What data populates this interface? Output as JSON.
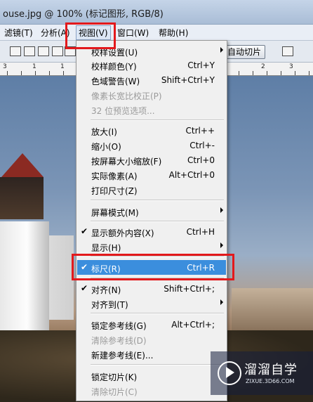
{
  "window": {
    "title": "ouse.jpg @ 100% (标记图形, RGB/8)"
  },
  "menubar": {
    "items": [
      {
        "label": "滤镜(T)"
      },
      {
        "label": "分析(A)"
      },
      {
        "label": "视图(V)",
        "active": true
      },
      {
        "label": "窗口(W)"
      },
      {
        "label": "帮助(H)"
      }
    ]
  },
  "options_bar": {
    "auto_slice_label": "自动切片"
  },
  "ruler": {
    "ticks": [
      "3",
      "1",
      "1",
      "2",
      "3"
    ]
  },
  "view_menu": {
    "items": [
      {
        "label": "校样设置(U)",
        "shortcut": "",
        "submenu": true
      },
      {
        "label": "校样颜色(Y)",
        "shortcut": "Ctrl+Y"
      },
      {
        "label": "色域警告(W)",
        "shortcut": "Shift+Ctrl+Y"
      },
      {
        "label": "像素长宽比校正(P)",
        "shortcut": "",
        "disabled": true
      },
      {
        "label": "32 位预览选项...",
        "shortcut": "",
        "disabled": true
      },
      {
        "label": "放大(I)",
        "shortcut": "Ctrl++"
      },
      {
        "label": "缩小(O)",
        "shortcut": "Ctrl+-"
      },
      {
        "label": "按屏幕大小缩放(F)",
        "shortcut": "Ctrl+0"
      },
      {
        "label": "实际像素(A)",
        "shortcut": "Alt+Ctrl+0"
      },
      {
        "label": "打印尺寸(Z)",
        "shortcut": ""
      },
      {
        "label": "屏幕模式(M)",
        "shortcut": "",
        "submenu": true
      },
      {
        "label": "显示额外内容(X)",
        "shortcut": "Ctrl+H",
        "checked": true
      },
      {
        "label": "显示(H)",
        "shortcut": "",
        "submenu": true
      },
      {
        "label": "标尺(R)",
        "shortcut": "Ctrl+R",
        "checked": true,
        "highlighted": true
      },
      {
        "label": "对齐(N)",
        "shortcut": "Shift+Ctrl+;",
        "checked": true
      },
      {
        "label": "对齐到(T)",
        "shortcut": "",
        "submenu": true
      },
      {
        "label": "锁定参考线(G)",
        "shortcut": "Alt+Ctrl+;"
      },
      {
        "label": "清除参考线(D)",
        "shortcut": "",
        "disabled": true
      },
      {
        "label": "新建参考线(E)...",
        "shortcut": ""
      },
      {
        "label": "锁定切片(K)",
        "shortcut": ""
      },
      {
        "label": "清除切片(C)",
        "shortcut": "",
        "disabled": true
      }
    ]
  },
  "watermark": {
    "title": "溜溜自学",
    "url": "ZIXUE.3D66.COM"
  },
  "colors": {
    "highlight": "#3b8edd",
    "annotation": "#e3191c"
  },
  "icons": [
    "align-top-edges-icon",
    "align-vertical-centers-icon",
    "align-bottom-edges-icon",
    "align-left-edges-icon",
    "align-horizontal-centers-icon",
    "align-right-edges-icon",
    "slice-options-icon",
    "check-icon",
    "submenu-arrow-icon",
    "play-icon"
  ]
}
